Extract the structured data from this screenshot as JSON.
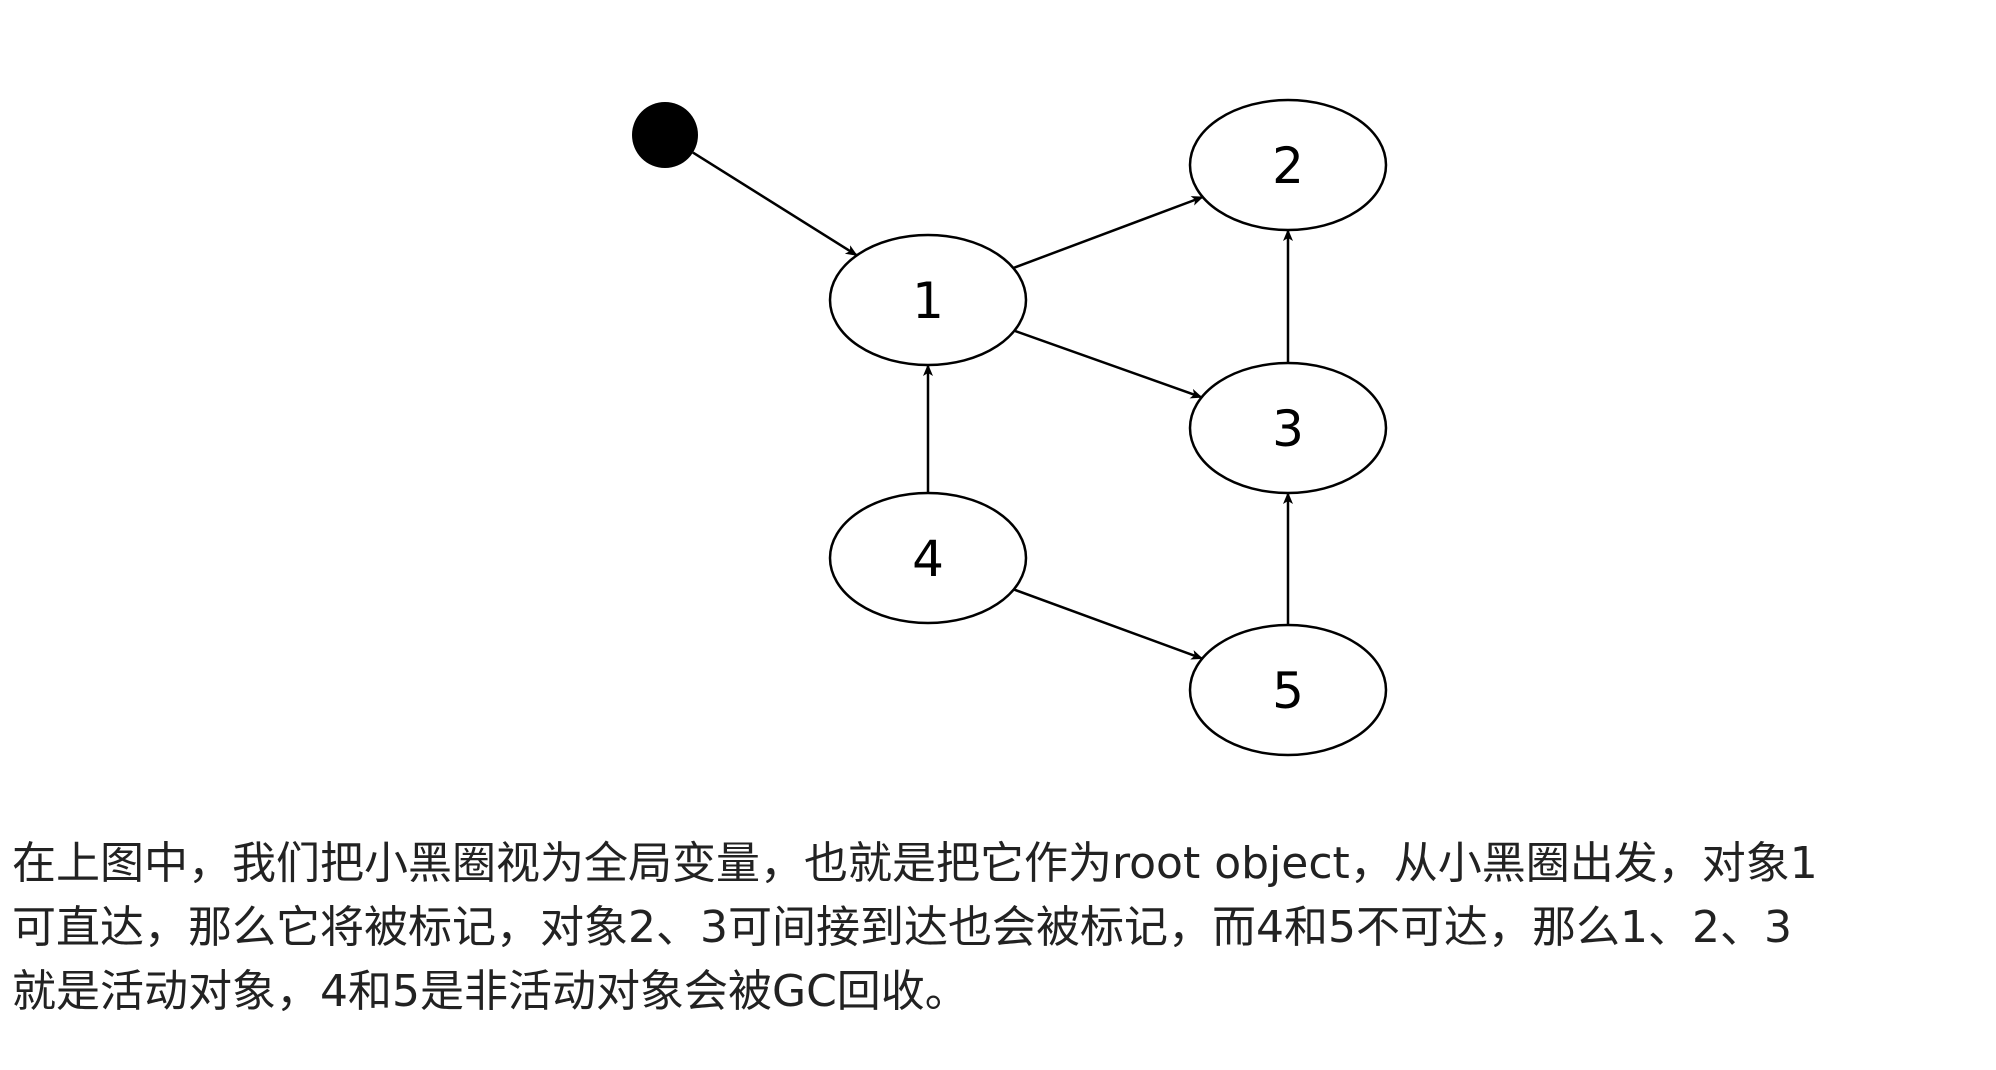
{
  "diagram": {
    "nodes": [
      {
        "id": "1",
        "label": "1"
      },
      {
        "id": "2",
        "label": "2"
      },
      {
        "id": "3",
        "label": "3"
      },
      {
        "id": "4",
        "label": "4"
      },
      {
        "id": "5",
        "label": "5"
      }
    ],
    "edges": [
      {
        "from": "root",
        "to": "1"
      },
      {
        "from": "1",
        "to": "2"
      },
      {
        "from": "1",
        "to": "3"
      },
      {
        "from": "3",
        "to": "2"
      },
      {
        "from": "4",
        "to": "1"
      },
      {
        "from": "4",
        "to": "5"
      },
      {
        "from": "5",
        "to": "3"
      }
    ],
    "colors": {
      "stroke": "#000000",
      "root_fill": "#000000",
      "node_fill": "#ffffff"
    }
  },
  "caption": {
    "lines": [
      "在上图中，我们把小黑圈视为全局变量，也就是把它作为root object，从小黑圈出发，对象1",
      "可直达，那么它将被标记，对象2、3可间接到达也会被标记，而4和5不可达，那么1、2、3",
      "就是活动对象，4和5是非活动对象会被GC回收。"
    ]
  }
}
